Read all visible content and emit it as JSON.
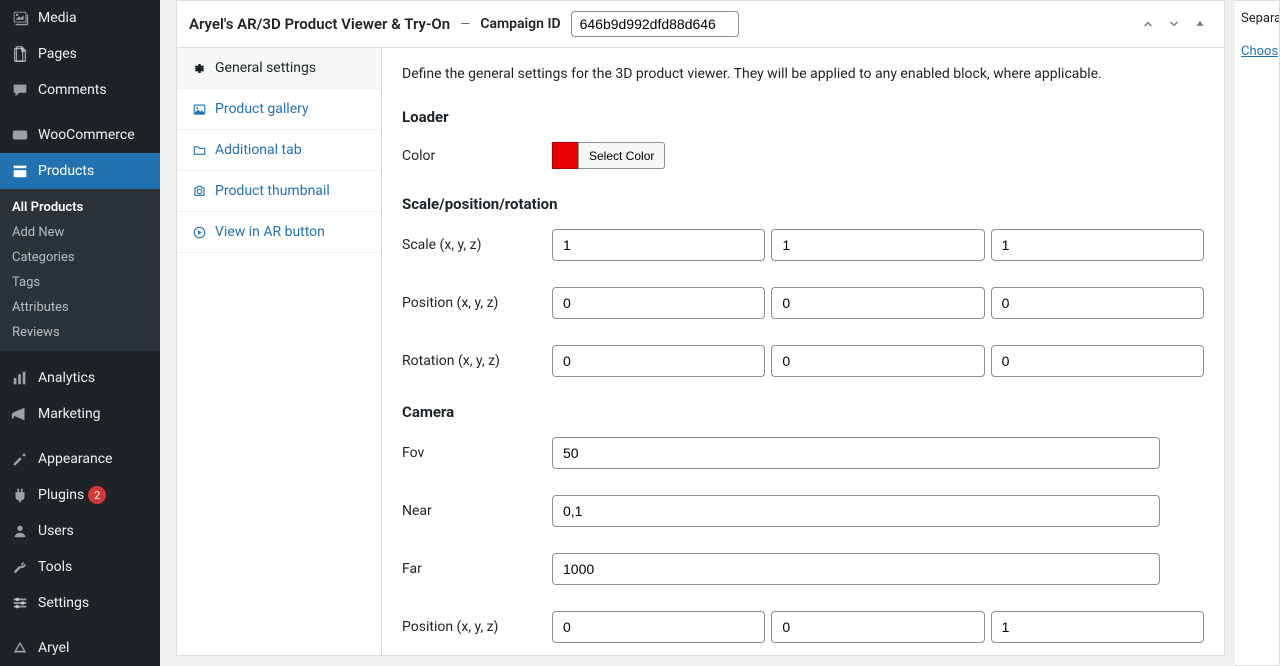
{
  "sidebar": {
    "items": [
      {
        "label": "Media"
      },
      {
        "label": "Pages"
      },
      {
        "label": "Comments"
      },
      {
        "label": "WooCommerce"
      },
      {
        "label": "Products"
      },
      {
        "label": "Analytics"
      },
      {
        "label": "Marketing"
      },
      {
        "label": "Appearance"
      },
      {
        "label": "Plugins"
      },
      {
        "label": "Users"
      },
      {
        "label": "Tools"
      },
      {
        "label": "Settings"
      },
      {
        "label": "Aryel"
      }
    ],
    "plugins_badge": "2",
    "submenu": [
      {
        "label": "All Products"
      },
      {
        "label": "Add New"
      },
      {
        "label": "Categories"
      },
      {
        "label": "Tags"
      },
      {
        "label": "Attributes"
      },
      {
        "label": "Reviews"
      }
    ]
  },
  "panel": {
    "title": "Aryel's AR/3D Product Viewer & Try-On",
    "sep": "—",
    "campaign_label": "Campaign ID",
    "campaign_value": "646b9d992dfd88d646"
  },
  "tabs": [
    {
      "label": "General settings"
    },
    {
      "label": "Product gallery"
    },
    {
      "label": "Additional tab"
    },
    {
      "label": "Product thumbnail"
    },
    {
      "label": "View in AR button"
    }
  ],
  "content": {
    "description": "Define the general settings for the 3D product viewer. They will be applied to any enabled block, where applicable.",
    "loader_h": "Loader",
    "loader_color_label": "Color",
    "loader_color_btn": "Select Color",
    "spr_h": "Scale/position/rotation",
    "scale_label": "Scale (x, y, z)",
    "scale": {
      "x": "1",
      "y": "1",
      "z": "1"
    },
    "position_label": "Position (x, y, z)",
    "position": {
      "x": "0",
      "y": "0",
      "z": "0"
    },
    "rotation_label": "Rotation (x, y, z)",
    "rotation": {
      "x": "0",
      "y": "0",
      "z": "0"
    },
    "camera_h": "Camera",
    "fov_label": "Fov",
    "fov": "50",
    "near_label": "Near",
    "near": "0,1",
    "far_label": "Far",
    "far": "1000",
    "cam_position_label": "Position (x, y, z)",
    "cam_position": {
      "x": "0",
      "y": "0",
      "z": "1"
    }
  },
  "rail": {
    "separa": "Separa",
    "choose": "Choos"
  }
}
